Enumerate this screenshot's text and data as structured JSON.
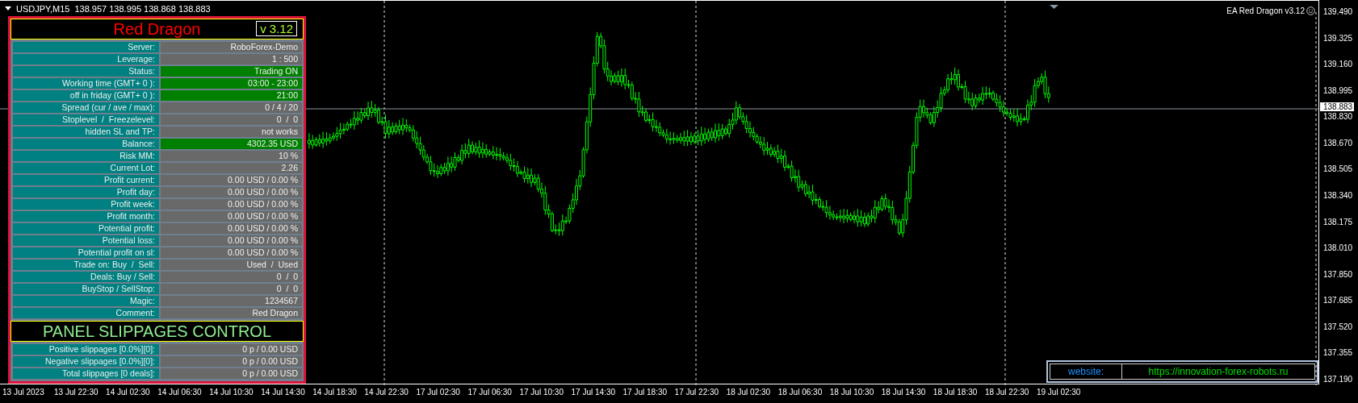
{
  "chart_header": {
    "symbol": "USDJPY,M15",
    "quotes": "138.957 138.995 138.868 138.883"
  },
  "expert_label": "EA Red Dragon v3.12",
  "panel": {
    "title": "Red Dragon",
    "version": "v 3.12",
    "rows": [
      {
        "label": "Server:",
        "value": "RoboForex-Demo",
        "highlighted": false
      },
      {
        "label": "Leverage:",
        "value": "1 : 500",
        "highlighted": false
      },
      {
        "label": "Status:",
        "value": "Trading ON",
        "highlighted": true
      },
      {
        "label": "Working time (GMT+ 0 ):",
        "value": "03:00 - 23:00",
        "highlighted": true
      },
      {
        "label": "off in friday (GMT+ 0 ):",
        "value": "21:00",
        "highlighted": true
      },
      {
        "label": "Spread (cur / ave / max):",
        "value": "0 / 4 / 20",
        "highlighted": false
      },
      {
        "label": "Stoplevel  /  Freezelevel:",
        "value": "0  /  0",
        "highlighted": false
      },
      {
        "label": "hidden SL and TP:",
        "value": "not works",
        "highlighted": false
      },
      {
        "label": "Balance:",
        "value": "4302.35 USD",
        "highlighted": true
      },
      {
        "label": "Risk MM:",
        "value": "10 %",
        "highlighted": false
      },
      {
        "label": "Current Lot:",
        "value": "2.26",
        "highlighted": false
      },
      {
        "label": "Profit current:",
        "value": "0.00 USD / 0.00 %",
        "highlighted": false
      },
      {
        "label": "Profit day:",
        "value": "0.00 USD / 0.00 %",
        "highlighted": false
      },
      {
        "label": "Profit week:",
        "value": "0.00 USD / 0.00 %",
        "highlighted": false
      },
      {
        "label": "Profit month:",
        "value": "0.00 USD / 0.00 %",
        "highlighted": false
      },
      {
        "label": "Potential profit:",
        "value": "0.00 USD / 0.00 %",
        "highlighted": false
      },
      {
        "label": "Potential loss:",
        "value": "0.00 USD / 0.00 %",
        "highlighted": false
      },
      {
        "label": "Potential profit on sl:",
        "value": "0.00 USD / 0.00 %",
        "highlighted": false
      },
      {
        "label": "Trade on: Buy  /  Sell:",
        "value": "Used  /  Used",
        "highlighted": false
      },
      {
        "label": "Deals: Buy / Sell:",
        "value": "0  /  0",
        "highlighted": false
      },
      {
        "label": "BuyStop / SellStop:",
        "value": "0  /  0",
        "highlighted": false
      },
      {
        "label": "Magic:",
        "value": "1234567",
        "highlighted": false
      },
      {
        "label": "Comment:",
        "value": "Red Dragon",
        "highlighted": false
      }
    ],
    "slippage_title": "PANEL SLIPPAGES CONTROL",
    "slippage_rows": [
      {
        "label": "Positive slippages [0.0%][0]:",
        "value": "0 p / 0.00 USD"
      },
      {
        "label": "Negative slippages [0.0%][0]:",
        "value": "0 p / 0.00 USD"
      },
      {
        "label": "Total slippages [0 deals]:",
        "value": "0 p / 0.00 USD"
      }
    ]
  },
  "website": {
    "label": "website:",
    "url": "https://innovation-forex-robots.ru"
  },
  "price_axis": {
    "labels": [
      "139.490",
      "139.325",
      "139.160",
      "138.995",
      "138.830",
      "138.670",
      "138.505",
      "138.340",
      "138.175",
      "138.010",
      "137.850",
      "137.685",
      "137.520",
      "137.355",
      "137.190"
    ],
    "current_price": "138.883"
  },
  "time_axis": [
    "13 Jul 2023",
    "13 Jul 22:30",
    "14 Jul 02:30",
    "14 Jul 06:30",
    "14 Jul 10:30",
    "14 Jul 14:30",
    "14 Jul 18:30",
    "14 Jul 22:30",
    "17 Jul 02:30",
    "17 Jul 06:30",
    "17 Jul 10:30",
    "17 Jul 14:30",
    "17 Jul 18:30",
    "17 Jul 22:30",
    "18 Jul 02:30",
    "18 Jul 06:30",
    "18 Jul 10:30",
    "18 Jul 14:30",
    "18 Jul 18:30",
    "18 Jul 22:30",
    "19 Jul 02:30"
  ]
}
